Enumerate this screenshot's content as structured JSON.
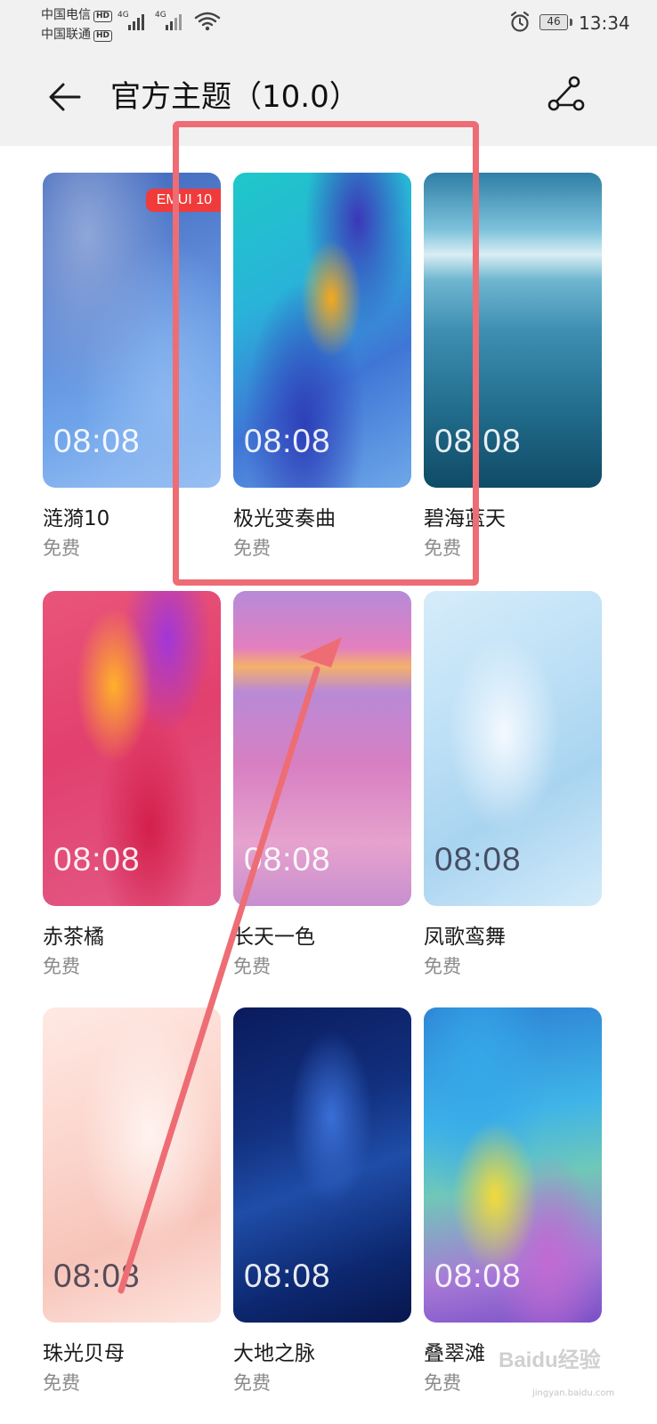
{
  "status_bar": {
    "carrier_1": "中国电信",
    "carrier_2": "中国联通",
    "hd_label": "HD",
    "network_1": "4G",
    "network_2": "4G",
    "battery_level": "46",
    "time": "13:34",
    "icons": [
      "signal-icon",
      "wifi-icon",
      "alarm-icon",
      "battery-icon"
    ]
  },
  "app_bar": {
    "title": "官方主题（10.0）",
    "icons": [
      "back-arrow-icon",
      "share-icon"
    ]
  },
  "themes": [
    {
      "name": "涟漪10",
      "price": "免费",
      "clock": "08:08",
      "badge": "EMUI 10"
    },
    {
      "name": "极光变奏曲",
      "price": "免费",
      "clock": "08:08"
    },
    {
      "name": "碧海蓝天",
      "price": "免费",
      "clock": "08:08"
    },
    {
      "name": "赤茶橘",
      "price": "免费",
      "clock": "08:08"
    },
    {
      "name": "长天一色",
      "price": "免费",
      "clock": "08:08"
    },
    {
      "name": "凤歌鸾舞",
      "price": "免费",
      "clock": "08:08"
    },
    {
      "name": "珠光贝母",
      "price": "免费",
      "clock": "08:08"
    },
    {
      "name": "大地之脉",
      "price": "免费",
      "clock": "08:08"
    },
    {
      "name": "叠翠滩",
      "price": "免费",
      "clock": "08:08"
    }
  ],
  "watermark": {
    "text": "Baidu经验",
    "sub": "jingyan.baidu.com"
  },
  "colors": {
    "annotation": "#ee6d74",
    "badge": "#f03b3b",
    "header_bg": "#f1f1f1"
  }
}
